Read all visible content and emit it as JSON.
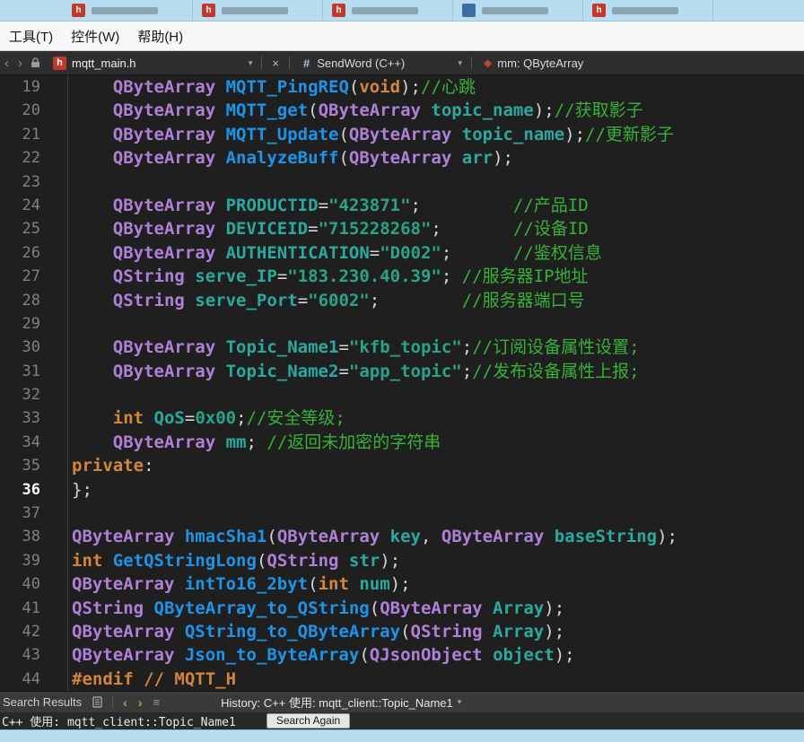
{
  "palette": {
    "editor_bg": "#1f1f1f",
    "type": "#b07fd8",
    "function": "#1e94e8",
    "variable": "#2aa9a0",
    "string": "#2aa489",
    "comment": "#38b138",
    "keyword": "#d2863b",
    "file_icon_red": "#c0392b",
    "member_diamond": "#b5443c",
    "window_strip_blue": "#b9ddf0"
  },
  "icons": {
    "back": "‹",
    "forward": "›",
    "caret": "▾",
    "close": "×",
    "hash": "#",
    "diamond": "◆",
    "list": "≡"
  },
  "top_strip": {
    "tabs": [
      {
        "color": "#c0392b",
        "glyph": "h"
      },
      {
        "color": "#c0392b",
        "glyph": "h"
      },
      {
        "color": "#c0392b",
        "glyph": "h"
      },
      {
        "color": "#3b6ea5",
        "glyph": ""
      },
      {
        "color": "#c0392b",
        "glyph": "h"
      }
    ]
  },
  "menu_bar": {
    "items": [
      {
        "label": "工具(T)"
      },
      {
        "label": "控件(W)"
      },
      {
        "label": "帮助(H)"
      }
    ]
  },
  "toolbar": {
    "file_tab": {
      "icon_letter": "h",
      "label": "mqtt_main.h"
    },
    "symbol_dropdown": {
      "label": "SendWord (C++)"
    },
    "member_indicator": {
      "label": "mm: QByteArray"
    }
  },
  "editor": {
    "lines": [
      {
        "n": 19,
        "t": [
          [
            "p",
            "    "
          ],
          [
            "ty",
            "QByteArray"
          ],
          [
            "p",
            " "
          ],
          [
            "fn",
            "MQTT_PingREQ"
          ],
          [
            "p",
            "("
          ],
          [
            "kw",
            "void"
          ],
          [
            "p",
            ");"
          ],
          [
            "cm",
            "//心跳"
          ]
        ]
      },
      {
        "n": 20,
        "t": [
          [
            "p",
            "    "
          ],
          [
            "ty",
            "QByteArray"
          ],
          [
            "p",
            " "
          ],
          [
            "fn",
            "MQTT_get"
          ],
          [
            "p",
            "("
          ],
          [
            "ty",
            "QByteArray"
          ],
          [
            "p",
            " "
          ],
          [
            "va",
            "topic_name"
          ],
          [
            "p",
            ");"
          ],
          [
            "cm",
            "//获取影子"
          ]
        ]
      },
      {
        "n": 21,
        "t": [
          [
            "p",
            "    "
          ],
          [
            "ty",
            "QByteArray"
          ],
          [
            "p",
            " "
          ],
          [
            "fn",
            "MQTT_Update"
          ],
          [
            "p",
            "("
          ],
          [
            "ty",
            "QByteArray"
          ],
          [
            "p",
            " "
          ],
          [
            "va",
            "topic_name"
          ],
          [
            "p",
            ");"
          ],
          [
            "cm",
            "//更新影子"
          ]
        ]
      },
      {
        "n": 22,
        "t": [
          [
            "p",
            "    "
          ],
          [
            "ty",
            "QByteArray"
          ],
          [
            "p",
            " "
          ],
          [
            "fn",
            "AnalyzeBuff"
          ],
          [
            "p",
            "("
          ],
          [
            "ty",
            "QByteArray"
          ],
          [
            "p",
            " "
          ],
          [
            "va",
            "arr"
          ],
          [
            "p",
            ");"
          ]
        ]
      },
      {
        "n": 23,
        "t": []
      },
      {
        "n": 24,
        "t": [
          [
            "p",
            "    "
          ],
          [
            "ty",
            "QByteArray"
          ],
          [
            "p",
            " "
          ],
          [
            "va",
            "PRODUCTID"
          ],
          [
            "p",
            "="
          ],
          [
            "st",
            "\"423871\""
          ],
          [
            "p",
            ";         "
          ],
          [
            "cm",
            "//产品ID"
          ]
        ]
      },
      {
        "n": 25,
        "t": [
          [
            "p",
            "    "
          ],
          [
            "ty",
            "QByteArray"
          ],
          [
            "p",
            " "
          ],
          [
            "va",
            "DEVICEID"
          ],
          [
            "p",
            "="
          ],
          [
            "st",
            "\"715228268\""
          ],
          [
            "p",
            ";       "
          ],
          [
            "cm",
            "//设备ID"
          ]
        ]
      },
      {
        "n": 26,
        "t": [
          [
            "p",
            "    "
          ],
          [
            "ty",
            "QByteArray"
          ],
          [
            "p",
            " "
          ],
          [
            "va",
            "AUTHENTICATION"
          ],
          [
            "p",
            "="
          ],
          [
            "st",
            "\"D002\""
          ],
          [
            "p",
            ";      "
          ],
          [
            "cm",
            "//鉴权信息"
          ]
        ]
      },
      {
        "n": 27,
        "t": [
          [
            "p",
            "    "
          ],
          [
            "ty",
            "QString"
          ],
          [
            "p",
            " "
          ],
          [
            "va",
            "serve_IP"
          ],
          [
            "p",
            "="
          ],
          [
            "st",
            "\"183.230.40.39\""
          ],
          [
            "p",
            "; "
          ],
          [
            "cm",
            "//服务器IP地址"
          ]
        ]
      },
      {
        "n": 28,
        "t": [
          [
            "p",
            "    "
          ],
          [
            "ty",
            "QString"
          ],
          [
            "p",
            " "
          ],
          [
            "va",
            "serve_Port"
          ],
          [
            "p",
            "="
          ],
          [
            "st",
            "\"6002\""
          ],
          [
            "p",
            ";        "
          ],
          [
            "cm",
            "//服务器端口号"
          ]
        ]
      },
      {
        "n": 29,
        "t": []
      },
      {
        "n": 30,
        "t": [
          [
            "p",
            "    "
          ],
          [
            "ty",
            "QByteArray"
          ],
          [
            "p",
            " "
          ],
          [
            "va",
            "Topic_Name1"
          ],
          [
            "p",
            "="
          ],
          [
            "st",
            "\"kfb_topic\""
          ],
          [
            "p",
            ";"
          ],
          [
            "cm",
            "//订阅设备属性设置;"
          ]
        ]
      },
      {
        "n": 31,
        "t": [
          [
            "p",
            "    "
          ],
          [
            "ty",
            "QByteArray"
          ],
          [
            "p",
            " "
          ],
          [
            "va",
            "Topic_Name2"
          ],
          [
            "p",
            "="
          ],
          [
            "st",
            "\"app_topic\""
          ],
          [
            "p",
            ";"
          ],
          [
            "cm",
            "//发布设备属性上报;"
          ]
        ]
      },
      {
        "n": 32,
        "t": []
      },
      {
        "n": 33,
        "t": [
          [
            "p",
            "    "
          ],
          [
            "kw",
            "int"
          ],
          [
            "p",
            " "
          ],
          [
            "va",
            "QoS"
          ],
          [
            "p",
            "="
          ],
          [
            "nu",
            "0x00"
          ],
          [
            "p",
            ";"
          ],
          [
            "cm",
            "//安全等级;"
          ]
        ]
      },
      {
        "n": 34,
        "t": [
          [
            "p",
            "    "
          ],
          [
            "ty",
            "QByteArray"
          ],
          [
            "p",
            " "
          ],
          [
            "va",
            "mm"
          ],
          [
            "p",
            "; "
          ],
          [
            "cm",
            "//返回未加密的字符串"
          ]
        ]
      },
      {
        "n": 35,
        "t": [
          [
            "kw",
            "private"
          ],
          [
            "p",
            ":"
          ]
        ]
      },
      {
        "n": 36,
        "cur": true,
        "t": [
          [
            "p",
            "};"
          ]
        ]
      },
      {
        "n": 37,
        "t": []
      },
      {
        "n": 38,
        "t": [
          [
            "ty",
            "QByteArray"
          ],
          [
            "p",
            " "
          ],
          [
            "fn",
            "hmacSha1"
          ],
          [
            "p",
            "("
          ],
          [
            "ty",
            "QByteArray"
          ],
          [
            "p",
            " "
          ],
          [
            "va",
            "key"
          ],
          [
            "p",
            ", "
          ],
          [
            "ty",
            "QByteArray"
          ],
          [
            "p",
            " "
          ],
          [
            "va",
            "baseString"
          ],
          [
            "p",
            ");"
          ]
        ]
      },
      {
        "n": 39,
        "t": [
          [
            "kw",
            "int"
          ],
          [
            "p",
            " "
          ],
          [
            "fn",
            "GetQStringLong"
          ],
          [
            "p",
            "("
          ],
          [
            "ty",
            "QString"
          ],
          [
            "p",
            " "
          ],
          [
            "va",
            "str"
          ],
          [
            "p",
            ");"
          ]
        ]
      },
      {
        "n": 40,
        "t": [
          [
            "ty",
            "QByteArray"
          ],
          [
            "p",
            " "
          ],
          [
            "fn",
            "intTo16_2byt"
          ],
          [
            "p",
            "("
          ],
          [
            "kw",
            "int"
          ],
          [
            "p",
            " "
          ],
          [
            "va",
            "num"
          ],
          [
            "p",
            ");"
          ]
        ]
      },
      {
        "n": 41,
        "t": [
          [
            "ty",
            "QString"
          ],
          [
            "p",
            " "
          ],
          [
            "fn",
            "QByteArray_to_QString"
          ],
          [
            "p",
            "("
          ],
          [
            "ty",
            "QByteArray"
          ],
          [
            "p",
            " "
          ],
          [
            "va",
            "Array"
          ],
          [
            "p",
            ");"
          ]
        ]
      },
      {
        "n": 42,
        "t": [
          [
            "ty",
            "QByteArray"
          ],
          [
            "p",
            " "
          ],
          [
            "fn",
            "QString_to_QByteArray"
          ],
          [
            "p",
            "("
          ],
          [
            "ty",
            "QString"
          ],
          [
            "p",
            " "
          ],
          [
            "va",
            "Array"
          ],
          [
            "p",
            ");"
          ]
        ]
      },
      {
        "n": 43,
        "t": [
          [
            "ty",
            "QByteArray"
          ],
          [
            "p",
            " "
          ],
          [
            "fn",
            "Json_to_ByteArray"
          ],
          [
            "p",
            "("
          ],
          [
            "ty",
            "QJsonObject"
          ],
          [
            "p",
            " "
          ],
          [
            "va",
            "object"
          ],
          [
            "p",
            ");"
          ]
        ]
      },
      {
        "n": 44,
        "t": [
          [
            "kw",
            "#endif"
          ],
          [
            "p",
            " "
          ],
          [
            "kw",
            "// MQTT_H"
          ]
        ]
      }
    ]
  },
  "results_panel": {
    "title": "Search Results",
    "history": "History: C++ 使用: mqtt_client::Topic_Name1",
    "result_text": "C++ 使用: mqtt_client::Topic_Name1",
    "search_again": "Search Again"
  }
}
